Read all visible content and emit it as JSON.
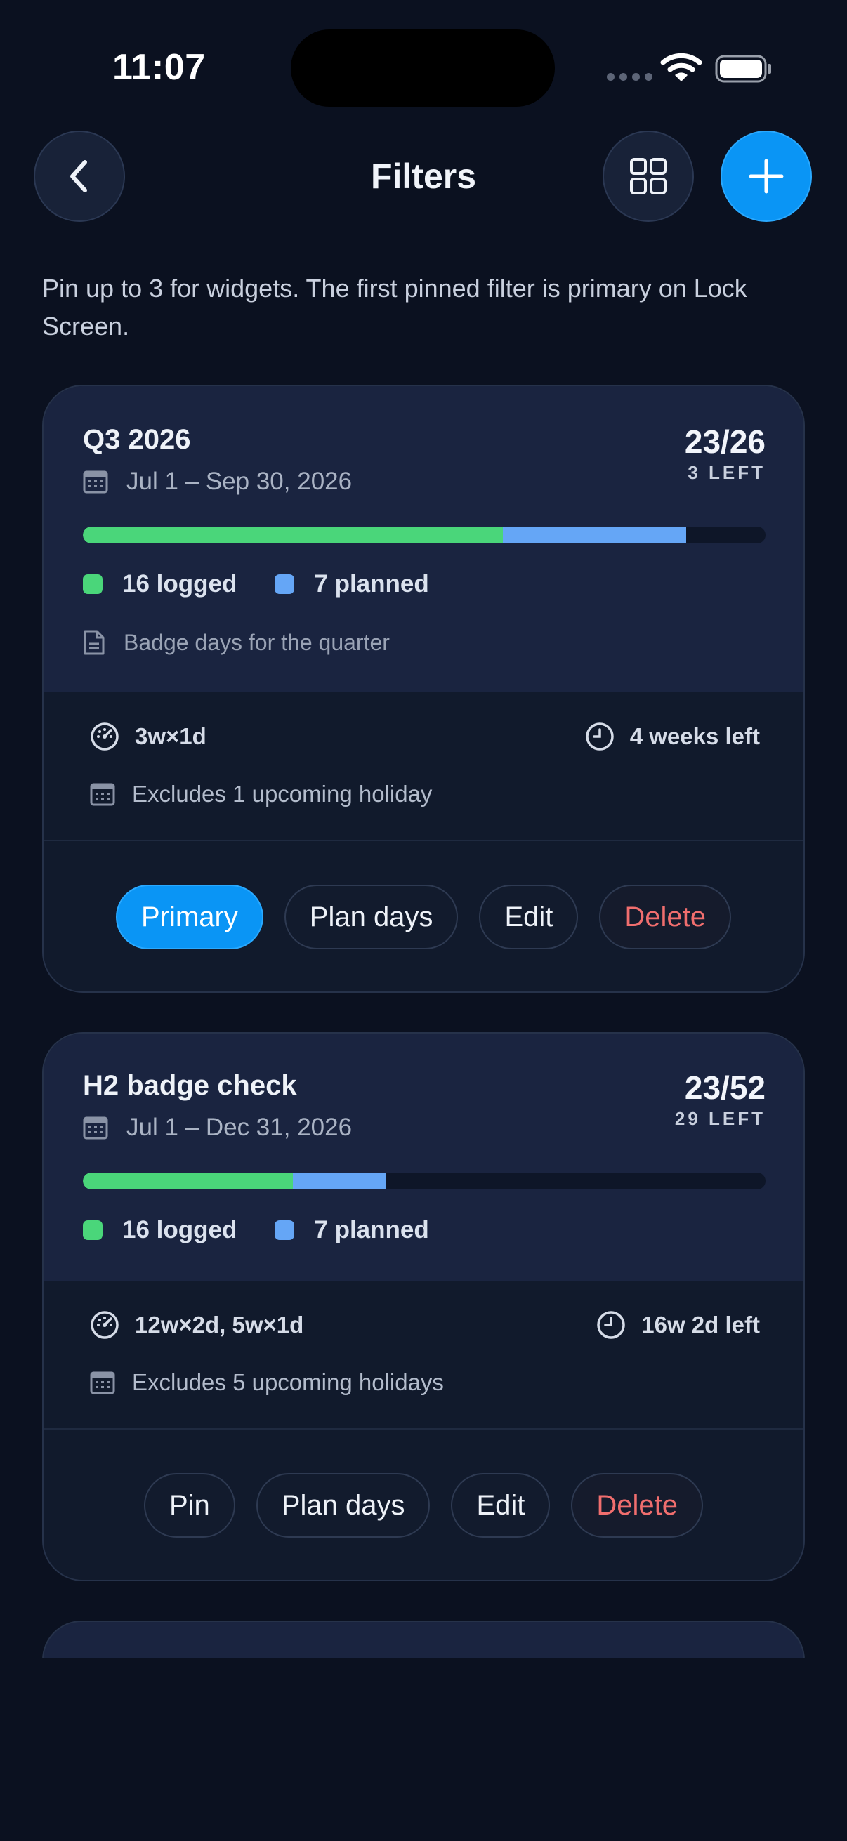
{
  "status_bar": {
    "time": "11:07"
  },
  "header": {
    "title": "Filters",
    "back_icon": "chevron-left-icon",
    "grid_icon": "grid-icon",
    "add_icon": "plus-icon"
  },
  "subtitle": "Pin up to 3 for widgets. The first pinned filter is primary on Lock Screen.",
  "colors": {
    "accent": "#0a95f5",
    "logged": "#4ad67a",
    "planned": "#65a6f6",
    "danger": "#f06e6e"
  },
  "filters": [
    {
      "title": "Q3 2026",
      "date_range": "Jul 1 – Sep 30, 2026",
      "count": "23/26",
      "left": "3 LEFT",
      "progress": {
        "logged_fraction": 0.615,
        "planned_fraction": 0.269
      },
      "logged": "16 logged",
      "planned": "7 planned",
      "note": "Badge days for the quarter",
      "pace": "3w×1d",
      "time_left": "4 weeks left",
      "exclusions": "Excludes 1 upcoming holiday",
      "actions": [
        "Primary",
        "Plan days",
        "Edit",
        "Delete"
      ]
    },
    {
      "title": "H2 badge check",
      "date_range": "Jul 1 – Dec 31, 2026",
      "count": "23/52",
      "left": "29 LEFT",
      "progress": {
        "logged_fraction": 0.308,
        "planned_fraction": 0.135
      },
      "logged": "16 logged",
      "planned": "7 planned",
      "pace": "12w×2d, 5w×1d",
      "time_left": "16w 2d left",
      "exclusions": "Excludes 5 upcoming holidays",
      "actions": [
        "Pin",
        "Plan days",
        "Edit",
        "Delete"
      ]
    }
  ]
}
